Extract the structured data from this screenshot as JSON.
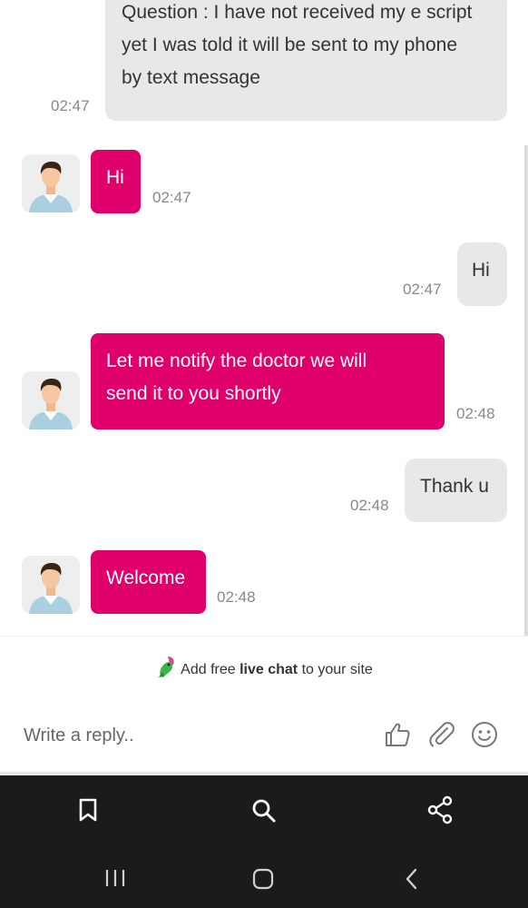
{
  "messages": [
    {
      "id": "m1",
      "from": "visitor",
      "text_lines": [
        "Question : I have not received my e script",
        "yet I was told it will be sent to my phone",
        "by text message"
      ],
      "time": "02:47"
    },
    {
      "id": "m2",
      "from": "agent",
      "text_lines": [
        "Hi"
      ],
      "time": "02:47"
    },
    {
      "id": "m3",
      "from": "visitor",
      "text_lines": [
        "Hi"
      ],
      "time": "02:47"
    },
    {
      "id": "m4",
      "from": "agent",
      "text_lines": [
        "Let me notify the doctor we will",
        "send it to you shortly"
      ],
      "time": "02:48"
    },
    {
      "id": "m5",
      "from": "visitor",
      "text_lines": [
        "Thank u"
      ],
      "time": "02:48"
    },
    {
      "id": "m6",
      "from": "agent",
      "text_lines": [
        "Welcome"
      ],
      "time": "02:48"
    }
  ],
  "branding": {
    "prefix": "Add free ",
    "bold": "live chat",
    "suffix": " to your site",
    "icon": "parrot-logo-icon"
  },
  "composer": {
    "placeholder": "Write a reply..",
    "icons": [
      "thumbs-up-icon",
      "paperclip-icon",
      "smiley-icon"
    ]
  },
  "browser_toolbar": {
    "icons": [
      "bookmark-icon",
      "search-icon",
      "share-icon"
    ]
  },
  "system_nav": {
    "icons": [
      "recent-apps-icon",
      "home-icon",
      "back-icon"
    ]
  },
  "colors": {
    "agent_bubble": "#e0006b",
    "visitor_bubble": "#e8e8e8",
    "toolbar_bg": "#1b1b1b"
  }
}
